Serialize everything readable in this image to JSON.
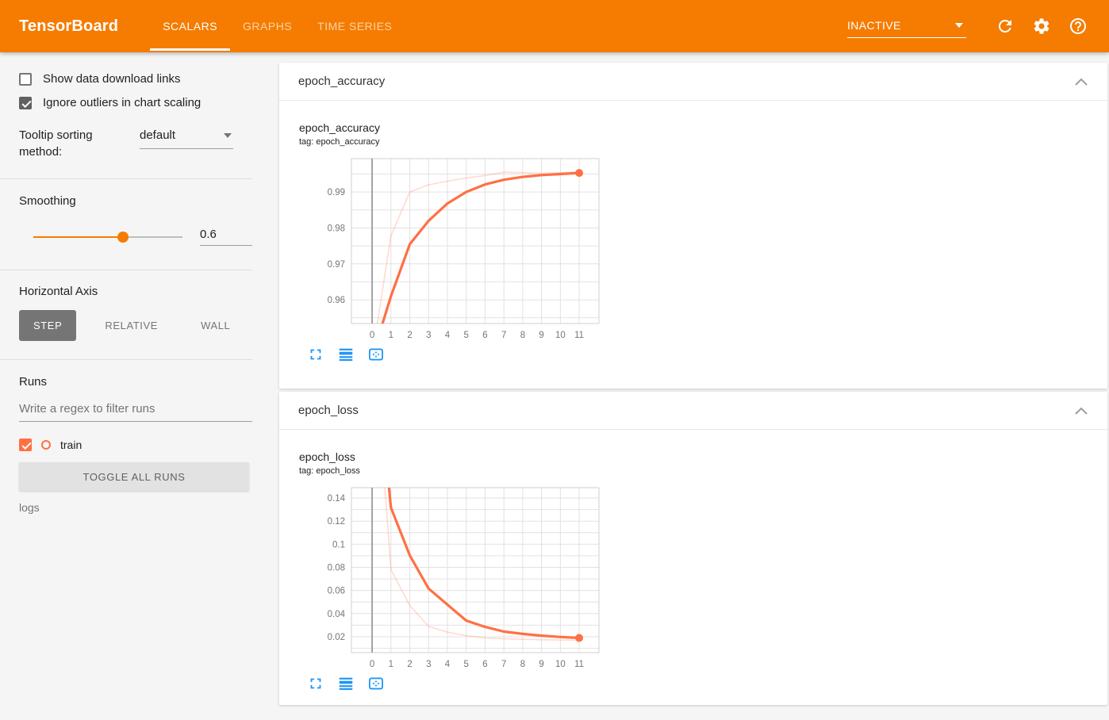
{
  "header": {
    "logo": "TensorBoard",
    "tabs": [
      {
        "label": "SCALARS",
        "active": true
      },
      {
        "label": "GRAPHS",
        "active": false
      },
      {
        "label": "TIME SERIES",
        "active": false
      }
    ],
    "status": "INACTIVE",
    "icons": [
      "refresh-icon",
      "settings-gear-icon",
      "help-icon"
    ]
  },
  "sidebar": {
    "checkboxes": [
      {
        "label": "Show data download links",
        "checked": false
      },
      {
        "label": "Ignore outliers in chart scaling",
        "checked": true
      }
    ],
    "tooltip_sorting": {
      "label": "Tooltip sorting method:",
      "value": "default"
    },
    "smoothing": {
      "label": "Smoothing",
      "value": "0.6",
      "percent": 60
    },
    "horizontal_axis": {
      "label": "Horizontal Axis",
      "options": [
        {
          "label": "STEP",
          "active": true
        },
        {
          "label": "RELATIVE",
          "active": false
        },
        {
          "label": "WALL",
          "active": false
        }
      ]
    },
    "runs": {
      "label": "Runs",
      "filter_placeholder": "Write a regex to filter runs",
      "items": [
        {
          "name": "train",
          "checked": true,
          "color": "#ff7043"
        }
      ],
      "toggle_all_label": "TOGGLE ALL RUNS",
      "directory": "logs"
    }
  },
  "cards": [
    {
      "title": "epoch_accuracy"
    },
    {
      "title": "epoch_loss"
    }
  ],
  "chart_data": [
    {
      "type": "line",
      "title": "epoch_accuracy",
      "tag": "tag: epoch_accuracy",
      "run": "train",
      "run_color": "#ff7043",
      "x": [
        0,
        1,
        2,
        3,
        4,
        5,
        6,
        7,
        8,
        9,
        10,
        11
      ],
      "x_ticks": [
        "0",
        "1",
        "2",
        "3",
        "4",
        "5",
        "6",
        "7",
        "8",
        "9",
        "10",
        "11"
      ],
      "xlim": [
        -1.1,
        12.05
      ],
      "ylim": [
        0.9534,
        0.9993
      ],
      "y_minor_step": 0.005,
      "y_ticks": [
        {
          "v": 0.96,
          "label": "0.96"
        },
        {
          "v": 0.97,
          "label": "0.97"
        },
        {
          "v": 0.98,
          "label": "0.98"
        },
        {
          "v": 0.99,
          "label": "0.99"
        }
      ],
      "grid": true,
      "legend": "none",
      "series": [
        {
          "name": "train (raw)",
          "style": "raw",
          "values": [
            0.944,
            0.9778,
            0.99,
            0.992,
            0.993,
            0.9939,
            0.9946,
            0.9955,
            0.9954,
            0.9952,
            0.9954,
            0.9956
          ]
        },
        {
          "name": "train (smoothed 0.6)",
          "style": "smoothed",
          "values": [
            0.944,
            0.961,
            0.9755,
            0.982,
            0.9868,
            0.99,
            0.9921,
            0.9934,
            0.9942,
            0.9947,
            0.995,
            0.9953
          ]
        }
      ]
    },
    {
      "type": "line",
      "title": "epoch_loss",
      "tag": "tag: epoch_loss",
      "run": "train",
      "run_color": "#ff7043",
      "x": [
        0,
        1,
        2,
        3,
        4,
        5,
        6,
        7,
        8,
        9,
        10,
        11
      ],
      "x_ticks": [
        "0",
        "1",
        "2",
        "3",
        "4",
        "5",
        "6",
        "7",
        "8",
        "9",
        "10",
        "11"
      ],
      "xlim": [
        -1.1,
        12.05
      ],
      "ylim": [
        0.0063,
        0.1489
      ],
      "y_minor_step": 0.01,
      "y_ticks": [
        {
          "v": 0.02,
          "label": "0.02"
        },
        {
          "v": 0.04,
          "label": "0.04"
        },
        {
          "v": 0.06,
          "label": "0.06"
        },
        {
          "v": 0.08,
          "label": "0.08"
        },
        {
          "v": 0.1,
          "label": "0.1"
        },
        {
          "v": 0.12,
          "label": "0.12"
        },
        {
          "v": 0.14,
          "label": "0.14"
        }
      ],
      "grid": true,
      "legend": "none",
      "series": [
        {
          "name": "train (raw)",
          "style": "raw",
          "values": [
            0.3,
            0.078,
            0.047,
            0.029,
            0.024,
            0.021,
            0.019,
            0.0182,
            0.0178,
            0.0174,
            0.0172,
            0.017
          ]
        },
        {
          "name": "train (smoothed 0.6)",
          "style": "smoothed",
          "values": [
            0.3,
            0.1317,
            0.0903,
            0.0616,
            0.0478,
            0.034,
            0.0285,
            0.0245,
            0.0225,
            0.021,
            0.0198,
            0.019
          ]
        }
      ]
    }
  ],
  "colors": {
    "header_bg": "#f57c00",
    "run_color": "#ff7043",
    "tool_icon_blue": "#2196f3",
    "grid_line": "#e2e2e2",
    "zero_line": "#999999"
  }
}
